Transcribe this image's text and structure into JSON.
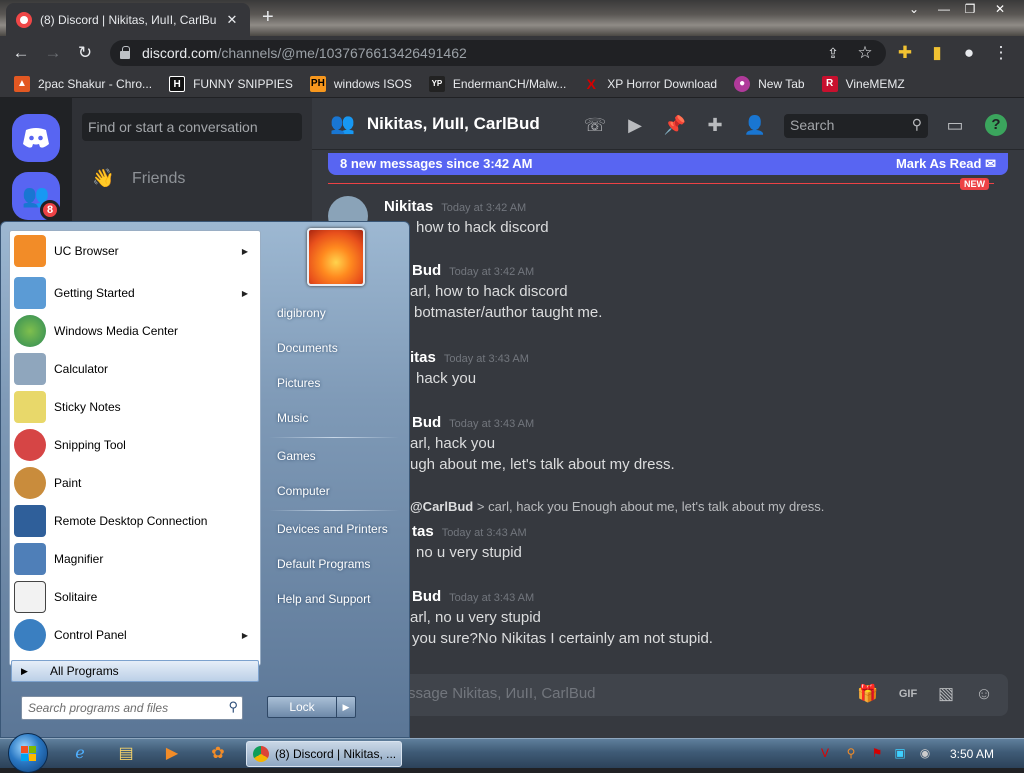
{
  "browser": {
    "tab_title": "(8) Discord | Nikitas, ИuII, CarlBu",
    "new_tab_label": "+",
    "url_host": "discord.com",
    "url_path": "/channels/@me/1037676613426491462",
    "bookmarks": [
      {
        "label": "2pac Shakur - Chro...",
        "icon": "fire-icon",
        "color": "#e25822"
      },
      {
        "label": "FUNNY SNIPPIES",
        "icon": "h-logo-icon",
        "color": "#111111"
      },
      {
        "label": "windows ISOS",
        "icon": "ph-logo-icon",
        "color": "#f7971d"
      },
      {
        "label": "EndermanCH/Malw...",
        "icon": "yp-logo-icon",
        "color": "#222222"
      },
      {
        "label": "XP Horror Download",
        "icon": "x-logo-icon",
        "color": "#d40000"
      },
      {
        "label": "New Tab",
        "icon": "chrome-icon",
        "color": "#b03a9a"
      },
      {
        "label": "VineMEMZ",
        "icon": "r-logo-icon",
        "color": "#c8102e"
      }
    ]
  },
  "discord": {
    "server_badge": "8",
    "dm_search_placeholder": "Find or start a conversation",
    "friends_label": "Friends",
    "channel_name": "Nikitas, ИuII, CarlBud",
    "search_placeholder": "Search",
    "help_label": "?",
    "new_messages_text": "8 new messages since 3:42 AM",
    "mark_read_label": "Mark As Read",
    "new_tag": "NEW",
    "messages": [
      {
        "author": "Nikitas",
        "time": "Today at 3:42 AM",
        "lines": [
          "how to hack discord"
        ]
      },
      {
        "author": "Bud",
        "time": "Today at 3:42 AM",
        "lines": [
          "arl, how to hack discord",
          "botmaster/author taught me."
        ]
      },
      {
        "author": "itas",
        "time": "Today at 3:43 AM",
        "lines": [
          "hack you"
        ]
      },
      {
        "author": "Bud",
        "time": "Today at 3:43 AM",
        "lines": [
          "arl, hack you",
          "ugh about me, let's talk about my dress."
        ]
      },
      {
        "author": "tas",
        "time": "Today at 3:43 AM",
        "lines": [
          "no u very stupid"
        ]
      },
      {
        "author": "Bud",
        "time": "Today at 3:43 AM",
        "lines": [
          "arl, no u very stupid",
          "you sure?No Nikitas I certainly am not stupid."
        ]
      }
    ],
    "reply": {
      "mention": "@CarlBud",
      "text": " > carl, hack you Enough about me, let's talk about my dress."
    },
    "composer_placeholder": "ssage Nikitas, ИuII, CarlBud"
  },
  "startmenu": {
    "programs": [
      {
        "label": "UC Browser",
        "submenu": true,
        "icon": "uc-browser-icon",
        "color": "#f28c28"
      },
      {
        "label": "Getting Started",
        "submenu": true,
        "icon": "getting-started-icon",
        "color": "#5b9bd5"
      },
      {
        "label": "Windows Media Center",
        "submenu": false,
        "icon": "media-center-icon",
        "color": "#2e8b57"
      },
      {
        "label": "Calculator",
        "submenu": false,
        "icon": "calculator-icon",
        "color": "#8fa6bd"
      },
      {
        "label": "Sticky Notes",
        "submenu": false,
        "icon": "sticky-notes-icon",
        "color": "#e8d86a"
      },
      {
        "label": "Snipping Tool",
        "submenu": false,
        "icon": "snipping-tool-icon",
        "color": "#d64545"
      },
      {
        "label": "Paint",
        "submenu": false,
        "icon": "paint-icon",
        "color": "#c98c3c"
      },
      {
        "label": "Remote Desktop Connection",
        "submenu": false,
        "icon": "remote-desktop-icon",
        "color": "#2f5f9a"
      },
      {
        "label": "Magnifier",
        "submenu": false,
        "icon": "magnifier-icon",
        "color": "#4f7fb8"
      },
      {
        "label": "Solitaire",
        "submenu": false,
        "icon": "solitaire-icon",
        "color": "#444444"
      },
      {
        "label": "Control Panel",
        "submenu": true,
        "icon": "control-panel-icon",
        "color": "#3a7fc1"
      }
    ],
    "all_programs": "All Programs",
    "search_placeholder": "Search programs and files",
    "places": [
      "digibrony",
      "Documents",
      "Pictures",
      "Music",
      "Games",
      "Computer",
      "Devices and Printers",
      "Default Programs",
      "Help and Support"
    ],
    "lock_label": "Lock"
  },
  "taskbar": {
    "chrome_task_label": "(8) Discord | Nikitas, ...",
    "time": "3:50 AM"
  }
}
